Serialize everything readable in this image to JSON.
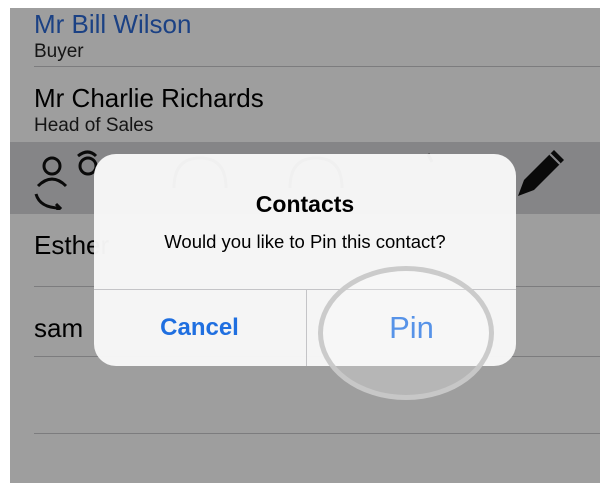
{
  "contacts": [
    {
      "name": "Mr Bill Wilson",
      "subtitle": "Buyer"
    },
    {
      "name": "Mr Charlie Richards",
      "subtitle": "Head of Sales"
    },
    {
      "name": "Esther",
      "subtitle": ""
    },
    {
      "name": "sam",
      "subtitle": ""
    }
  ],
  "action_icons": [
    "reassign-users-icon",
    "chat-bubble-icon",
    "chat-bubble-icon",
    "pin-icon",
    "pencil-icon"
  ],
  "alert": {
    "title": "Contacts",
    "message": "Would you like to Pin this contact?",
    "cancel_label": "Cancel",
    "confirm_label": "Pin"
  },
  "colors": {
    "accent": "#1f6fe0",
    "link_name": "#2c6ad6"
  }
}
